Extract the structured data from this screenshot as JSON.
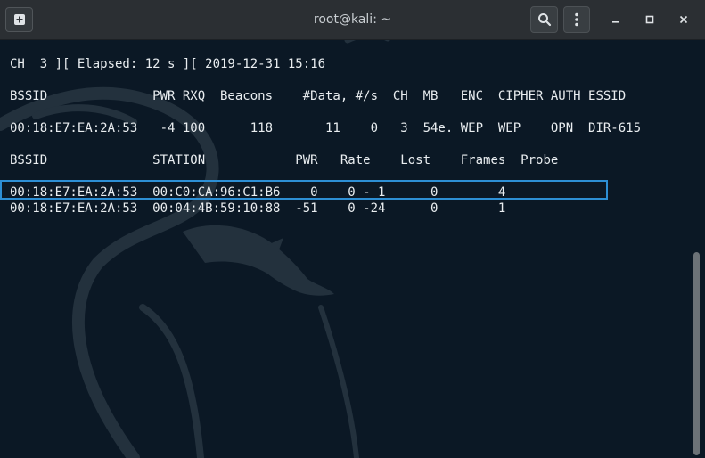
{
  "window": {
    "title": "root@kali: ~"
  },
  "icons": {
    "new_tab": "new-tab-icon",
    "search": "search-icon",
    "menu": "kebab-menu-icon",
    "minimize": "minimize-icon",
    "maximize": "maximize-icon",
    "close": "close-icon"
  },
  "colors": {
    "terminal_bg": "#0b1825",
    "titlebar_bg": "#2b2f33",
    "text": "#e9edf0",
    "highlight": "#2d8fd5",
    "dragon": "#23313d"
  },
  "terminal": {
    "status_line": "CH  3 ][ Elapsed: 12 s ][ 2019-12-31 15:16",
    "ap_header": "BSSID              PWR RXQ  Beacons    #Data, #/s  CH  MB   ENC  CIPHER AUTH ESSID",
    "ap_rows": [
      "00:18:E7:EA:2A:53   -4 100      118       11    0   3  54e. WEP  WEP    OPN  DIR-615"
    ],
    "station_header": "BSSID              STATION            PWR   Rate    Lost    Frames  Probe",
    "station_rows": [
      "00:18:E7:EA:2A:53  00:C0:CA:96:C1:B6    0    0 - 1      0        4",
      "00:18:E7:EA:2A:53  00:04:4B:59:10:88  -51    0 -24      0        1"
    ]
  }
}
